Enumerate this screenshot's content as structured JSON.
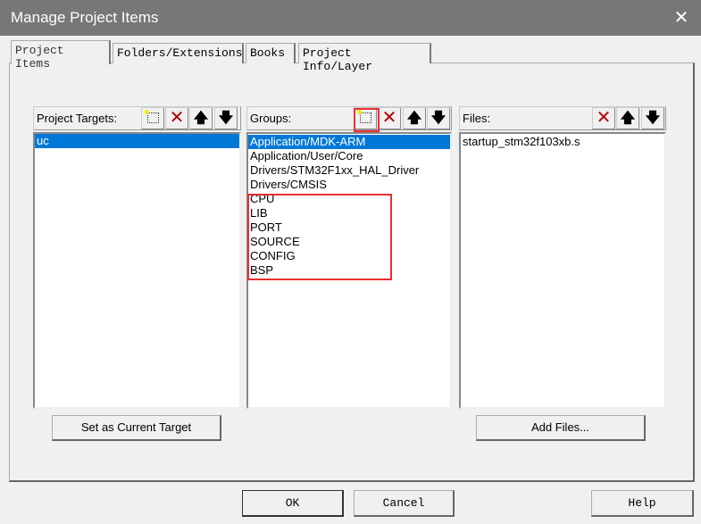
{
  "window": {
    "title": "Manage Project Items",
    "close_icon": "close-icon"
  },
  "tabs": [
    {
      "label": "Project Items",
      "active": true
    },
    {
      "label": "Folders/Extensions"
    },
    {
      "label": "Books"
    },
    {
      "label": "Project Info/Layer"
    }
  ],
  "targets": {
    "label": "Project Targets:",
    "items": [
      "uc"
    ],
    "selected": 0
  },
  "groups": {
    "label": "Groups:",
    "items": [
      "Application/MDK-ARM",
      "Application/User/Core",
      "Drivers/STM32F1xx_HAL_Driver",
      "Drivers/CMSIS",
      "CPU",
      "LIB",
      "PORT",
      "SOURCE",
      "CONFIG",
      "BSP"
    ],
    "selected": 0
  },
  "files": {
    "label": "Files:",
    "items": [
      "startup_stm32f103xb.s"
    ]
  },
  "buttons": {
    "set_target": "Set as Current Target",
    "add_files": "Add Files...",
    "ok": "OK",
    "cancel": "Cancel",
    "help": "Help"
  },
  "colors": {
    "selection": "#0078d7",
    "highlight": "#e83030",
    "delete": "#b00000"
  }
}
